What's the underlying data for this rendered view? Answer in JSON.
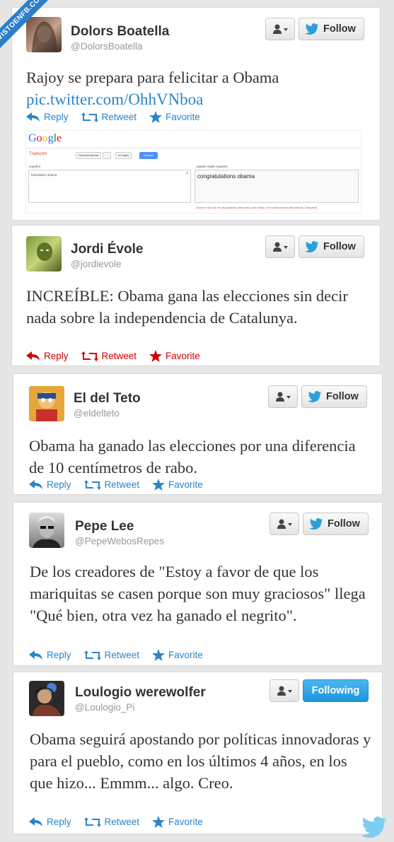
{
  "watermark": "VISTOENFB.COM",
  "colors": {
    "link": "#2a85c8",
    "red": "#d20000",
    "follow_blue": "#1d95dd"
  },
  "tweets": [
    {
      "name": "Dolors Boatella",
      "handle": "@DolorsBoatella",
      "follow_label": "Follow",
      "text": "Rajoy se prepara para felicitar a Obama",
      "link": "pic.twitter.com/OhhVNboa",
      "actions": {
        "reply": "Reply",
        "retweet": "Retweet",
        "favorite": "Favorite"
      },
      "media": {
        "logo": "Google",
        "app": "Traductor",
        "src_lang": "Detectar idioma",
        "tgt_lang": "Al inglés",
        "translate_btn": "Traducir",
        "src_tabs": "español",
        "tgt_tabs": "catalán   inglés   español",
        "src_text": "felicidades obama",
        "tgt_text": "congratulations obama",
        "note": "¡Nuevo! Haz clic en las palabras anteriores para editar y ver traducciones alternativas. Descartar"
      }
    },
    {
      "name": "Jordi Évole",
      "handle": "@jordievole",
      "follow_label": "Follow",
      "text": "INCREÍBLE: Obama gana las elecciones sin decir nada sobre la independencia de Catalunya.",
      "actions": {
        "reply": "Reply",
        "retweet": "Retweet",
        "favorite": "Favorite"
      }
    },
    {
      "name": "El del Teto",
      "handle": "@eldelteto",
      "follow_label": "Follow",
      "text": "Obama ha ganado las elecciones por una diferencia de 10 centímetros de rabo.",
      "actions": {
        "reply": "Reply",
        "retweet": "Retweet",
        "favorite": "Favorite"
      }
    },
    {
      "name": "Pepe Lee",
      "handle": "@PepeWebosRepes",
      "follow_label": "Follow",
      "text": "De los creadores de \"Estoy a favor de que los mariquitas se casen porque son muy graciosos\" llega \"Qué bien, otra vez ha ganado el negrito\".",
      "actions": {
        "reply": "Reply",
        "retweet": "Retweet",
        "favorite": "Favorite"
      }
    },
    {
      "name": "Loulogio werewolfer",
      "handle": "@Loulogio_Pi",
      "follow_label": "Following",
      "text": "Obama seguirá apostando por políticas innovadoras y para el pueblo, como en los últimos 4 años, en los que hizo... Emmm... algo. Creo.",
      "actions": {
        "reply": "Reply",
        "retweet": "Retweet",
        "favorite": "Favorite"
      }
    }
  ]
}
